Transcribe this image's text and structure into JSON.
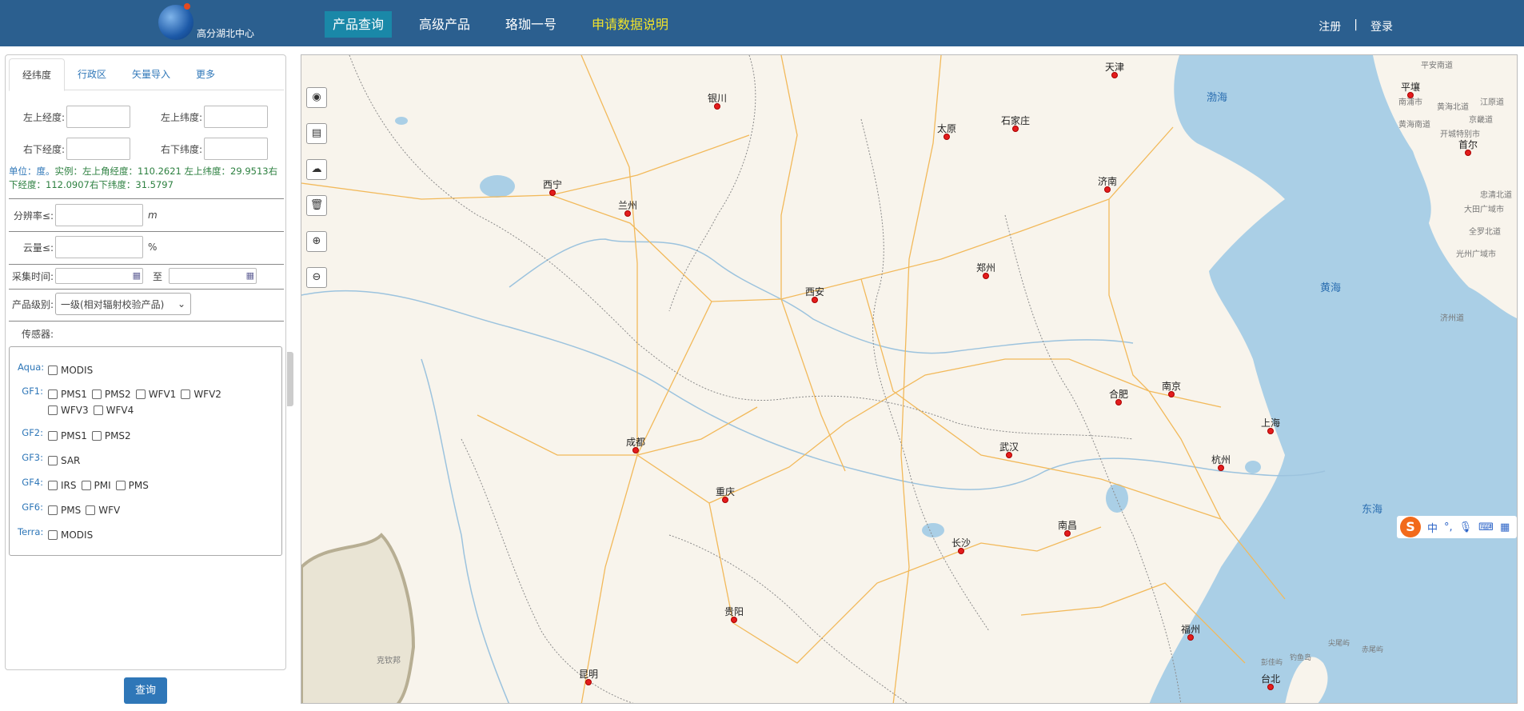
{
  "header": {
    "logo_text": "高分湖北中心",
    "nav": [
      {
        "label": "产品查询",
        "active": true
      },
      {
        "label": "高级产品",
        "active": false
      },
      {
        "label": "珞珈一号",
        "active": false
      },
      {
        "label": "申请数据说明",
        "active": false,
        "highlight": "#f2e32a"
      }
    ],
    "register": "注册",
    "divider": "|",
    "login": "登录"
  },
  "panel": {
    "tabs": [
      "经纬度",
      "行政区",
      "矢量导入",
      "更多"
    ],
    "coords": {
      "ul_lon_label": "左上经度:",
      "ul_lat_label": "左上纬度:",
      "lr_lon_label": "右下经度:",
      "lr_lat_label": "右下纬度:",
      "hint_unit": "单位：度。",
      "hint_example": "实例：左上角经度：110.2621 左上纬度：29.9513右下经度：112.0907右下纬度：31.5797"
    },
    "resolution_label": "分辨率≤:",
    "resolution_unit": "m",
    "cloud_label": "云量≤:",
    "cloud_unit": "%",
    "time_label": "采集时间:",
    "time_to": "至",
    "level_label": "产品级别:",
    "level_value": "一级(相对辐射校验产品)",
    "sensor_label": "传感器:",
    "sensors": [
      {
        "name": "Aqua:",
        "options": [
          "MODIS"
        ]
      },
      {
        "name": "GF1:",
        "options": [
          "PMS1",
          "PMS2",
          "WFV1",
          "WFV2",
          "WFV3",
          "WFV4"
        ]
      },
      {
        "name": "GF2:",
        "options": [
          "PMS1",
          "PMS2"
        ]
      },
      {
        "name": "GF3:",
        "options": [
          "SAR"
        ]
      },
      {
        "name": "GF4:",
        "options": [
          "IRS",
          "PMI",
          "PMS"
        ]
      },
      {
        "name": "GF6:",
        "options": [
          "PMS",
          "WFV"
        ]
      },
      {
        "name": "Terra:",
        "options": [
          "MODIS"
        ]
      }
    ],
    "query_button": "查询"
  },
  "map": {
    "tools": [
      "locate-icon",
      "layers-icon",
      "cloud-icon",
      "trash-icon",
      "zoom-in-icon",
      "zoom-out-icon"
    ],
    "cities": [
      "天津",
      "银川",
      "太原",
      "石家庄",
      "西宁",
      "兰州",
      "济南",
      "郑州",
      "西安",
      "合肥",
      "南京",
      "上海",
      "成都",
      "武汉",
      "杭州",
      "重庆",
      "南昌",
      "长沙",
      "贵阳",
      "福州",
      "昆明",
      "台北",
      "平壤",
      "首尔"
    ],
    "seas": [
      "渤海",
      "黄海",
      "东海"
    ],
    "minor_labels": [
      "平安南道",
      "南浦市",
      "黄海北道",
      "江原道",
      "黄海南道",
      "京畿道",
      "开城特别市",
      "忠清北道",
      "大田广域市",
      "全罗北道",
      "光州广域市",
      "济州道",
      "克钦邦",
      "尖尾屿",
      "钓鱼岛",
      "赤尾屿",
      "彭佳屿"
    ],
    "ime": {
      "logo": "S",
      "lang": "中",
      "punct": "°,"
    }
  }
}
